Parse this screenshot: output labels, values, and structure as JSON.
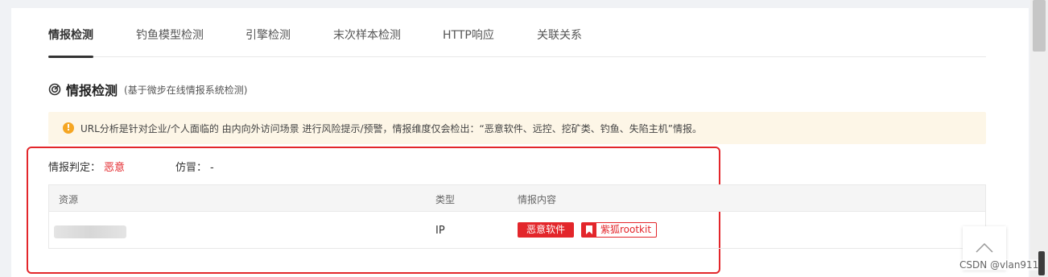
{
  "tabs": [
    {
      "label": "情报检测",
      "active": true
    },
    {
      "label": "钓鱼模型检测",
      "active": false
    },
    {
      "label": "引擎检测",
      "active": false
    },
    {
      "label": "末次样本检测",
      "active": false
    },
    {
      "label": "HTTP响应",
      "active": false
    },
    {
      "label": "关联关系",
      "active": false
    }
  ],
  "section": {
    "icon": "radar-icon",
    "title": "情报检测",
    "subtitle": "(基于微步在线情报系统检测)"
  },
  "notice": {
    "icon": "info-circle-icon",
    "text": "URL分析是针对企业/个人面临的 由内向外访问场景 进行风险提示/预警，情报维度仅会检出：“恶意软件、远控、挖矿类、钓鱼、失陷主机”情报。"
  },
  "verdict": {
    "label": "情报判定：",
    "value": "恶意"
  },
  "imitation": {
    "label": "仿冒：",
    "value": "-"
  },
  "table": {
    "headers": [
      "资源",
      "类型",
      "情报内容"
    ],
    "rows": [
      {
        "resource": "",
        "type": "IP",
        "tags": [
          "恶意软件",
          "紫狐rootkit"
        ]
      }
    ]
  },
  "back_to_top": {
    "icon": "chevron-up-icon"
  },
  "watermark": "CSDN @vlan911",
  "colors": {
    "danger": "#e3262b",
    "notice_bg": "#fdf6e7",
    "warning": "#f5a623"
  }
}
